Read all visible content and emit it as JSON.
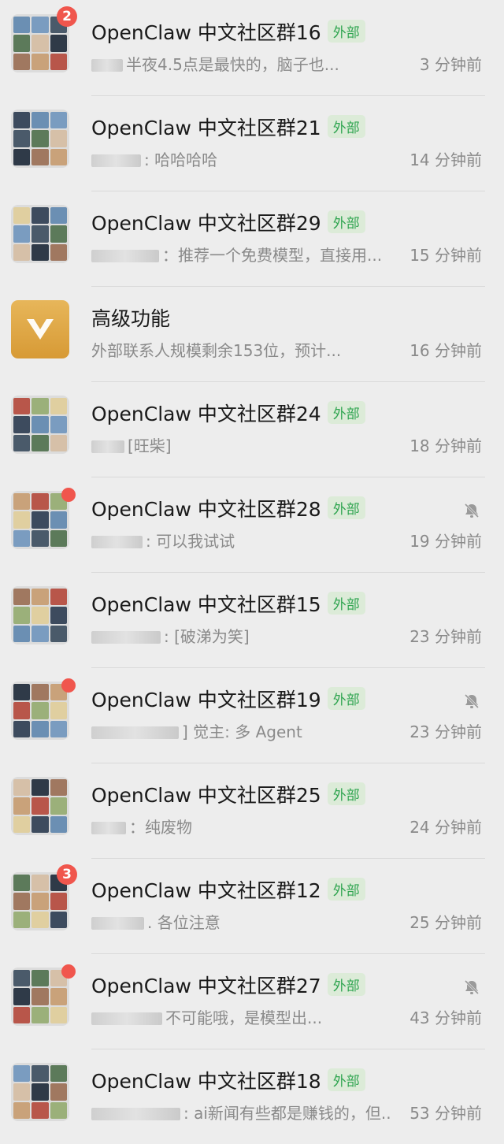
{
  "chats": [
    {
      "title": "OpenClaw 中文社区群16",
      "tag": "外部",
      "preview": "半夜4.5点是最快的，脑子也...",
      "time": "3 分钟前",
      "badge": "2",
      "dot": false,
      "muted": false
    },
    {
      "title": "OpenClaw 中文社区群21",
      "tag": "外部",
      "preview": ": 哈哈哈哈",
      "time": "14 分钟前",
      "badge": "",
      "dot": false,
      "muted": false
    },
    {
      "title": "OpenClaw 中文社区群29",
      "tag": "外部",
      "preview": "：推荐一个免费模型，直接用...",
      "time": "15 分钟前",
      "badge": "",
      "dot": false,
      "muted": false
    },
    {
      "title": "高级功能",
      "tag": "",
      "preview": "外部联系人规模剩余153位，预计...",
      "time": "16 分钟前",
      "badge": "",
      "dot": false,
      "muted": false
    },
    {
      "title": "OpenClaw 中文社区群24",
      "tag": "外部",
      "preview": "[旺柴]",
      "time": "18 分钟前",
      "badge": "",
      "dot": false,
      "muted": false
    },
    {
      "title": "OpenClaw 中文社区群28",
      "tag": "外部",
      "preview": ": 可以我试试",
      "time": "19 分钟前",
      "badge": "",
      "dot": true,
      "muted": true
    },
    {
      "title": "OpenClaw 中文社区群15",
      "tag": "外部",
      "preview": ": [破涕为笑]",
      "time": "23 分钟前",
      "badge": "",
      "dot": false,
      "muted": false
    },
    {
      "title": "OpenClaw 中文社区群19",
      "tag": "外部",
      "preview": "] 觉主: 多 Agent",
      "time": "23 分钟前",
      "badge": "",
      "dot": true,
      "muted": true
    },
    {
      "title": "OpenClaw 中文社区群25",
      "tag": "外部",
      "preview": "：纯废物",
      "time": "24 分钟前",
      "badge": "",
      "dot": false,
      "muted": false
    },
    {
      "title": "OpenClaw 中文社区群12",
      "tag": "外部",
      "preview": ". 各位注意",
      "time": "25 分钟前",
      "badge": "3",
      "dot": false,
      "muted": false
    },
    {
      "title": "OpenClaw 中文社区群27",
      "tag": "外部",
      "preview": "不可能哦，是模型出...",
      "time": "43 分钟前",
      "badge": "",
      "dot": true,
      "muted": true
    },
    {
      "title": "OpenClaw 中文社区群18",
      "tag": "外部",
      "preview": ": ai新闻有些都是赚钱的，但...",
      "time": "53 分钟前",
      "badge": "",
      "dot": false,
      "muted": false
    }
  ],
  "colors": {
    "background": "#ededed",
    "tag_text": "#2ea44f",
    "tag_bg": "#dcebd8",
    "badge": "#f0564d",
    "secondary_text": "#8a8a8a",
    "feature_avatar": "#e0a845"
  },
  "icons": {
    "group_avatar": "group-avatar-grid",
    "feature_avatar": "v-logo-icon",
    "muted": "bell-slash-icon"
  }
}
